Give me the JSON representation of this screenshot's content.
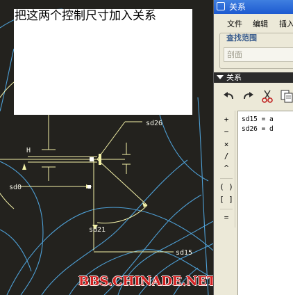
{
  "note": {
    "text": "把这两个控制尺寸加入关系"
  },
  "watermark": {
    "text": "BBS.CHINADE.NET"
  },
  "drawing": {
    "labels": {
      "sd26": "sd26",
      "sd0": "sd0",
      "sd21": "sd21",
      "sd15": "sd15",
      "h": "H"
    }
  },
  "dialog": {
    "title": "关系",
    "menu": {
      "file": "文件",
      "edit": "编辑",
      "insert": "插入"
    },
    "scope": {
      "legend": "查找范围",
      "value": "剖面"
    },
    "relations_header": "关系",
    "operators": [
      "+",
      "−",
      "×",
      "/",
      "^",
      "( )",
      "[ ]",
      "="
    ],
    "relations": [
      "sd15 = a",
      "sd26 = d"
    ]
  },
  "colors": {
    "canvas": "#23221e",
    "curve_blue": "#4ea0d6",
    "curve_yellow": "#f4f2a8",
    "watermark": "#d32020",
    "titlebar": "#1d5ad0"
  }
}
